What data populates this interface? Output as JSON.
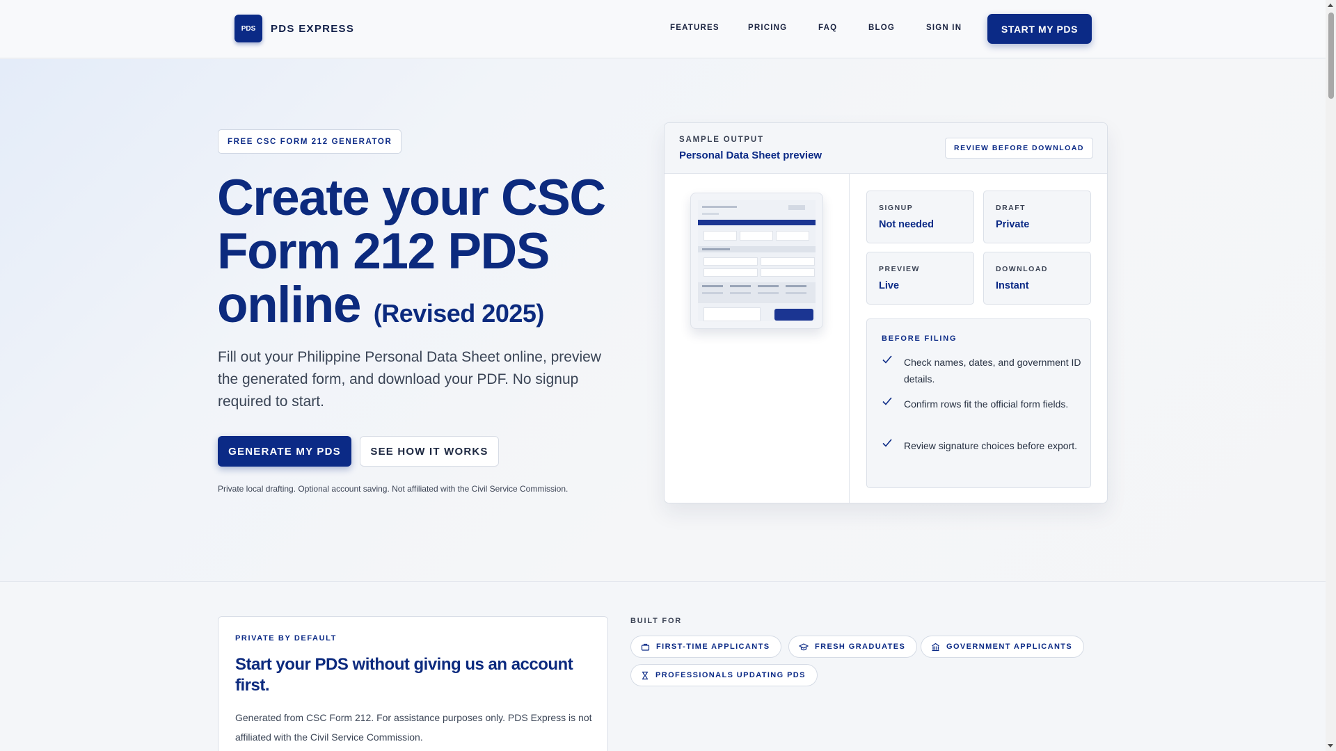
{
  "header": {
    "logo_text": "PDS",
    "brand": "PDS EXPRESS",
    "nav": [
      "FEATURES",
      "PRICING",
      "FAQ",
      "BLOG",
      "SIGN IN"
    ],
    "cta": "START MY PDS"
  },
  "hero": {
    "chip": "FREE CSC FORM 212 GENERATOR",
    "title_line1": "Create your CSC",
    "title_line2": "Form 212 PDS",
    "title_line3": "online",
    "title_suffix": "(Revised 2025)",
    "subtitle": "Fill out your Philippine Personal Data Sheet online, preview the generated form, and download your PDF. No signup required to start.",
    "primary_button": "GENERATE MY PDS",
    "secondary_button": "SEE HOW IT WORKS",
    "disclaimer": "Private local drafting. Optional account saving. Not affiliated with the Civil Service Commission."
  },
  "sample": {
    "eyebrow": "SAMPLE OUTPUT",
    "title": "Personal Data Sheet preview",
    "badge": "REVIEW BEFORE DOWNLOAD",
    "stats": [
      {
        "label": "SIGNUP",
        "value": "Not needed"
      },
      {
        "label": "DRAFT",
        "value": "Private"
      },
      {
        "label": "PREVIEW",
        "value": "Live"
      },
      {
        "label": "DOWNLOAD",
        "value": "Instant"
      }
    ],
    "checklist_title": "BEFORE FILING",
    "checklist": [
      "Check names, dates, and government ID details.",
      "Confirm rows fit the official form fields.",
      "Review signature choices before export."
    ]
  },
  "privacy": {
    "eyebrow": "PRIVATE BY DEFAULT",
    "title": "Start your PDS without giving us an account first.",
    "text": "Generated from CSC Form 212. For assistance purposes only. PDS Express is not affiliated with the Civil Service Commission."
  },
  "built_for": {
    "label": "BUILT FOR",
    "items": [
      {
        "label": "FIRST-TIME APPLICANTS",
        "icon": "briefcase-icon"
      },
      {
        "label": "FRESH GRADUATES",
        "icon": "graduation-cap-icon"
      },
      {
        "label": "GOVERNMENT APPLICANTS",
        "icon": "building-icon"
      },
      {
        "label": "PROFESSIONALS UPDATING PDS",
        "icon": "hourglass-icon"
      }
    ]
  },
  "colors": {
    "brand": "#0b2a86",
    "background": "#f4f6f9",
    "card": "#ffffff"
  }
}
